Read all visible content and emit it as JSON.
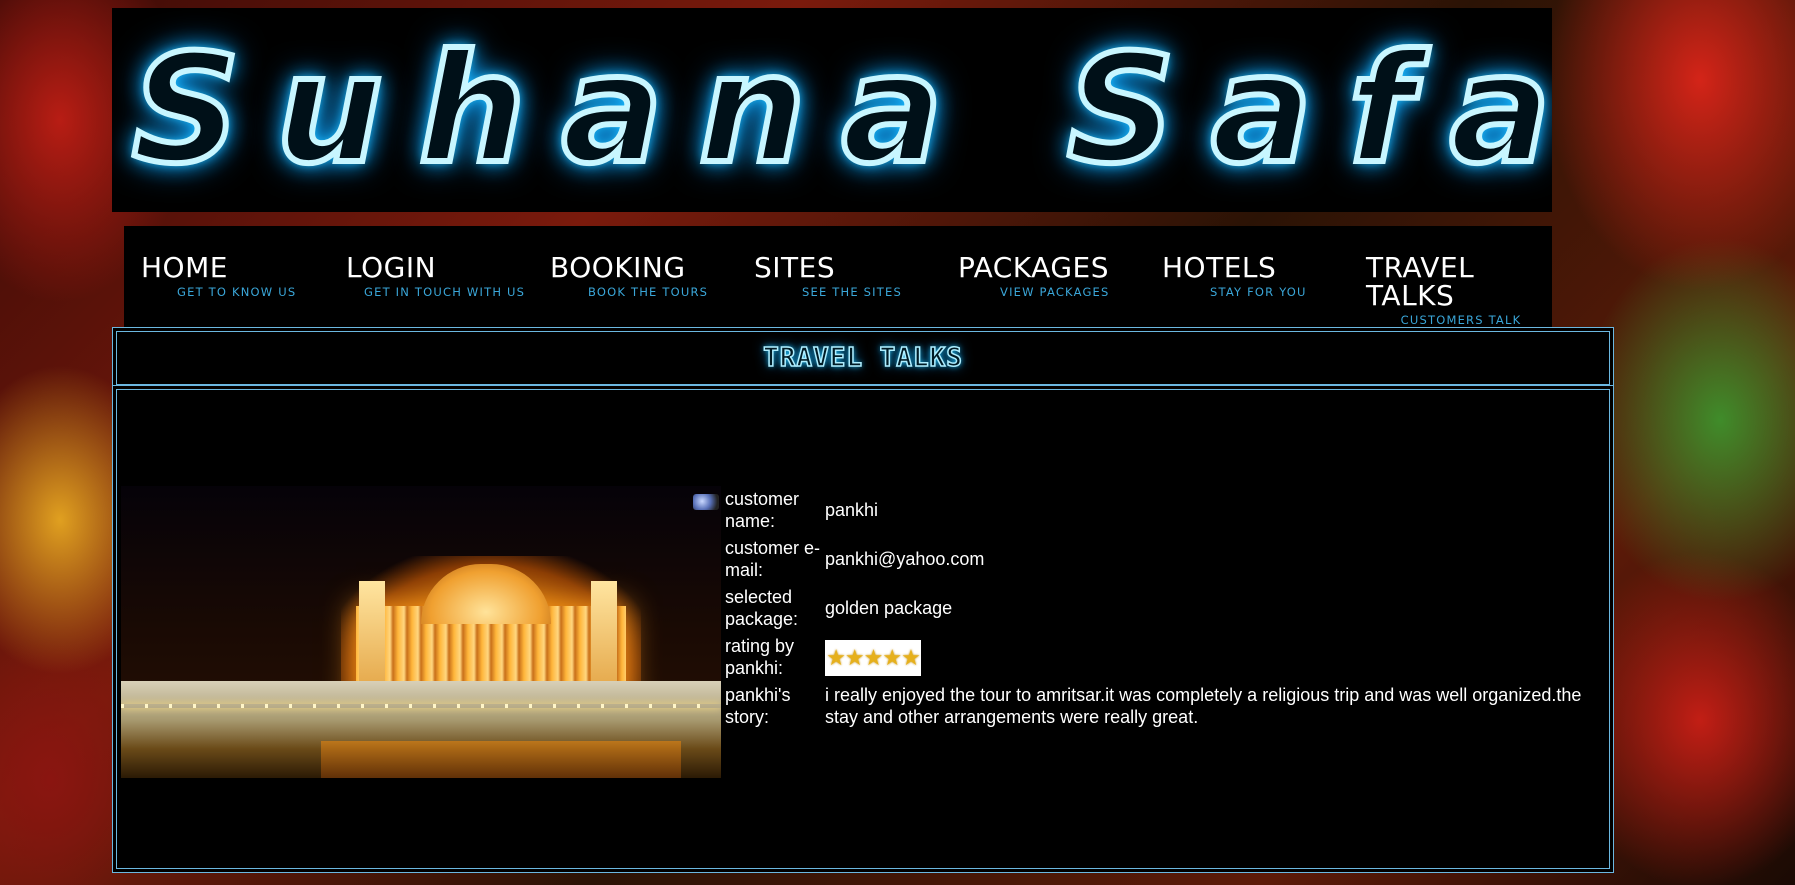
{
  "site": {
    "banner_title": "Suhana Safar"
  },
  "nav": {
    "items": [
      {
        "label": "HOME",
        "sub": "GET TO KNOW US"
      },
      {
        "label": "LOGIN",
        "sub": "GET IN TOUCH WITH US"
      },
      {
        "label": "BOOKING",
        "sub": "BOOK THE TOURS"
      },
      {
        "label": "SITES",
        "sub": "SEE THE SITES"
      },
      {
        "label": "PACKAGES",
        "sub": "VIEW PACKAGES"
      },
      {
        "label": "HOTELS",
        "sub": "STAY FOR YOU"
      },
      {
        "label": "TRAVEL TALKS",
        "sub": "CUSTOMERS TALK ABOUT TRAVEL"
      }
    ]
  },
  "page": {
    "section_title": "TRAVEL TALKS"
  },
  "review": {
    "customer_name_label": "customer name:",
    "customer_name": "pankhi",
    "customer_email_label": "customer e-mail:",
    "customer_email": "pankhi@yahoo.com",
    "package_label": "selected package:",
    "package": "golden package",
    "rating_label": "rating by pankhi:",
    "rating_stars": "★★★★★",
    "rating_value": 5,
    "rating_max": 5,
    "story_label": "pankhi's story:",
    "story": "i really enjoyed the tour to amritsar.it was completely a religious trip and was well organized.the stay and other arrangements were really great."
  },
  "icons": {
    "avatar": "user-avatar-icon",
    "photo": "golden-temple-photo"
  },
  "colors": {
    "nav_sub": "#3aa6d8",
    "border": "#6bb7e0",
    "neon": "#22c8ff"
  }
}
